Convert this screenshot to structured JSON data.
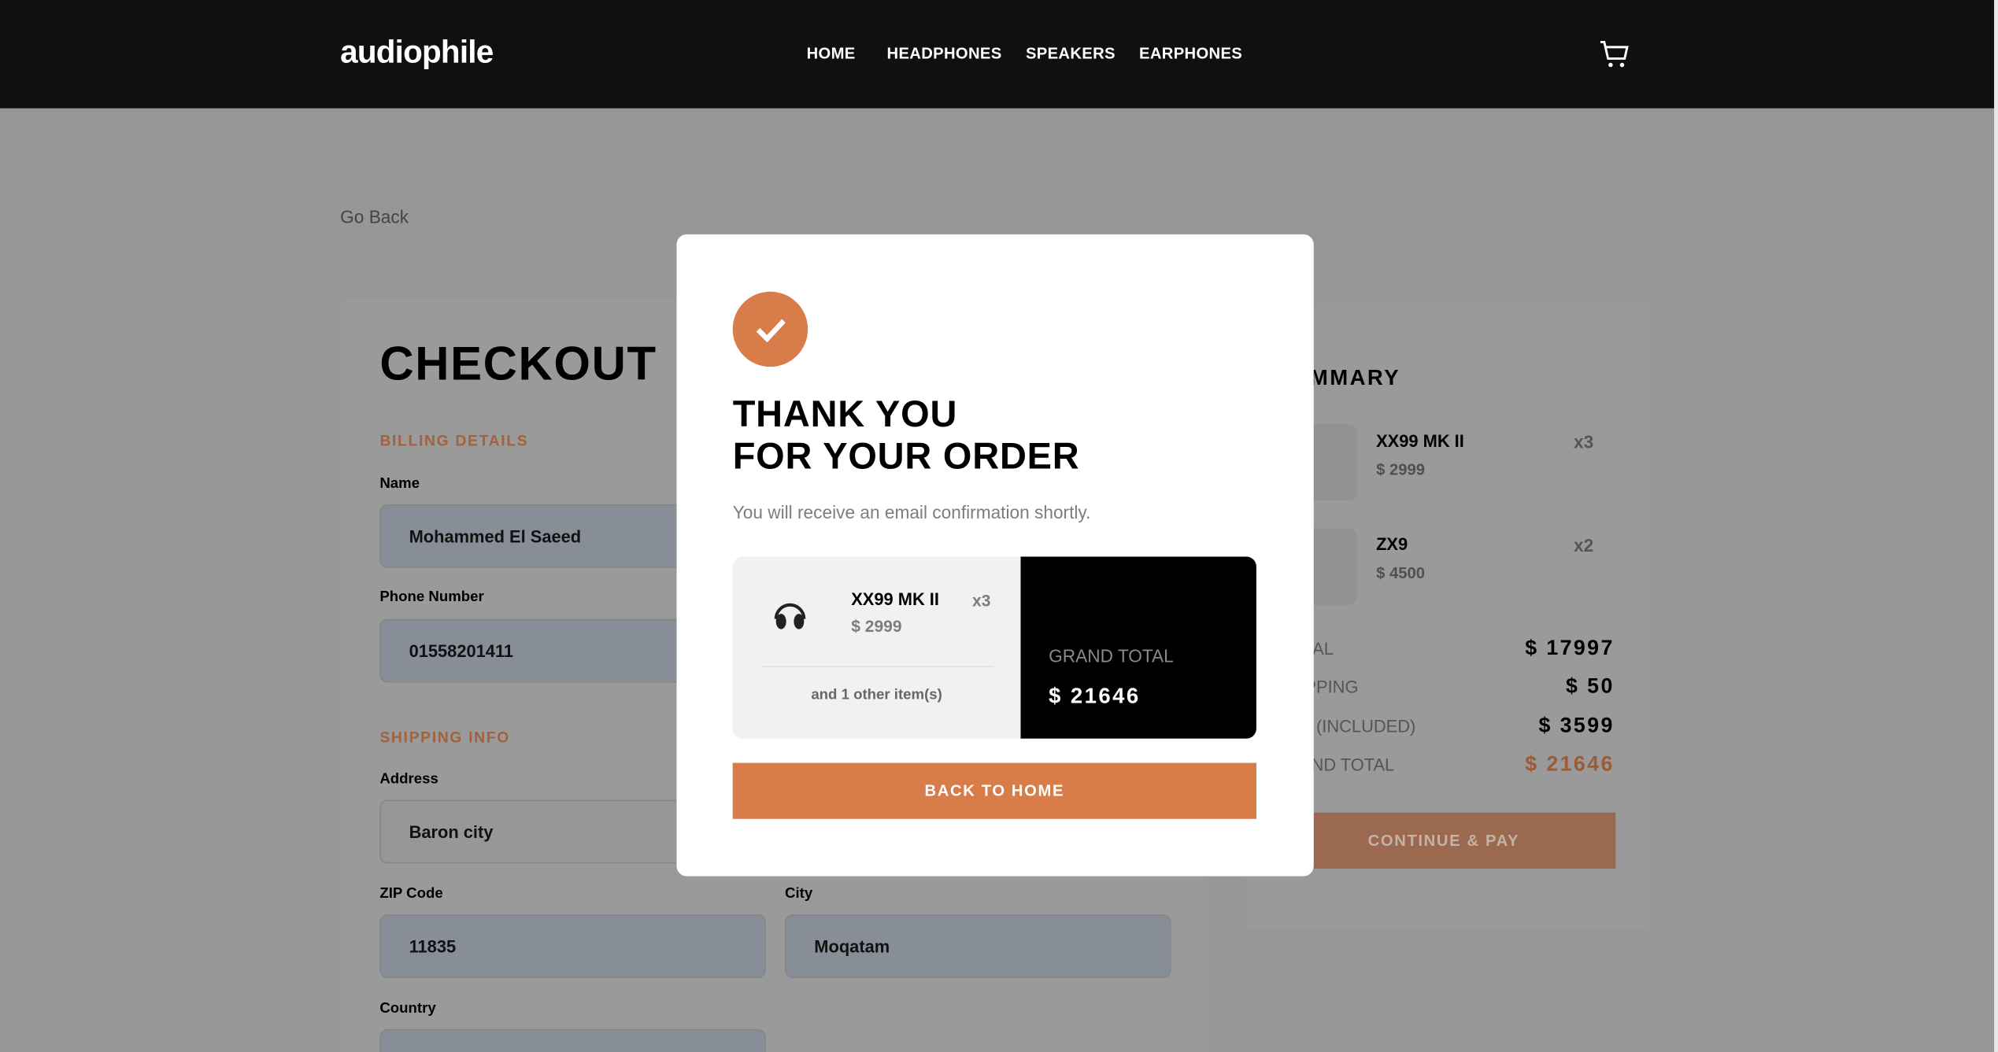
{
  "header": {
    "logo": "audiophile",
    "nav": [
      "HOME",
      "HEADPHONES",
      "SPEAKERS",
      "EARPHONES"
    ],
    "cart_icon": "cart-icon"
  },
  "go_back": "Go Back",
  "checkout": {
    "title": "CHECKOUT",
    "billing_title": "BILLING DETAILS",
    "name_label": "Name",
    "name_value": "Mohammed El Saeed",
    "phone_label": "Phone Number",
    "phone_value": "01558201411",
    "shipping_title": "SHIPPING INFO",
    "address_label": "Address",
    "address_value": "Baron city",
    "zip_label": "ZIP Code",
    "zip_value": "11835",
    "city_label": "City",
    "city_value": "Moqatam",
    "country_label": "Country"
  },
  "summary": {
    "title": "MMARY",
    "items": [
      {
        "name": "XX99 MK II",
        "price": "$ 2999",
        "qty": "x3"
      },
      {
        "name": "ZX9",
        "price": "$ 4500",
        "qty": "x2"
      }
    ],
    "totals": [
      {
        "label": "AL",
        "value": "$ 17997"
      },
      {
        "label": "PPING",
        "value": "$ 50"
      },
      {
        "label": "(INCLUDED)",
        "value": "$ 3599"
      },
      {
        "label": "ND TOTAL",
        "value": "$ 21646"
      }
    ],
    "continue": "CONTINUE & PAY"
  },
  "modal": {
    "title_line1": "THANK YOU",
    "title_line2": "FOR YOUR ORDER",
    "subtitle": "You will receive an email confirmation shortly.",
    "item": {
      "name": "XX99 MK II",
      "price": "$ 2999",
      "qty": "x3"
    },
    "others": "and 1 other item(s)",
    "grand_total_label": "GRAND TOTAL",
    "grand_total_value": "$ 21646",
    "button": "BACK TO HOME"
  },
  "colors": {
    "accent": "#d87d4a",
    "header": "#101010",
    "overlay_bg": "#979797"
  }
}
